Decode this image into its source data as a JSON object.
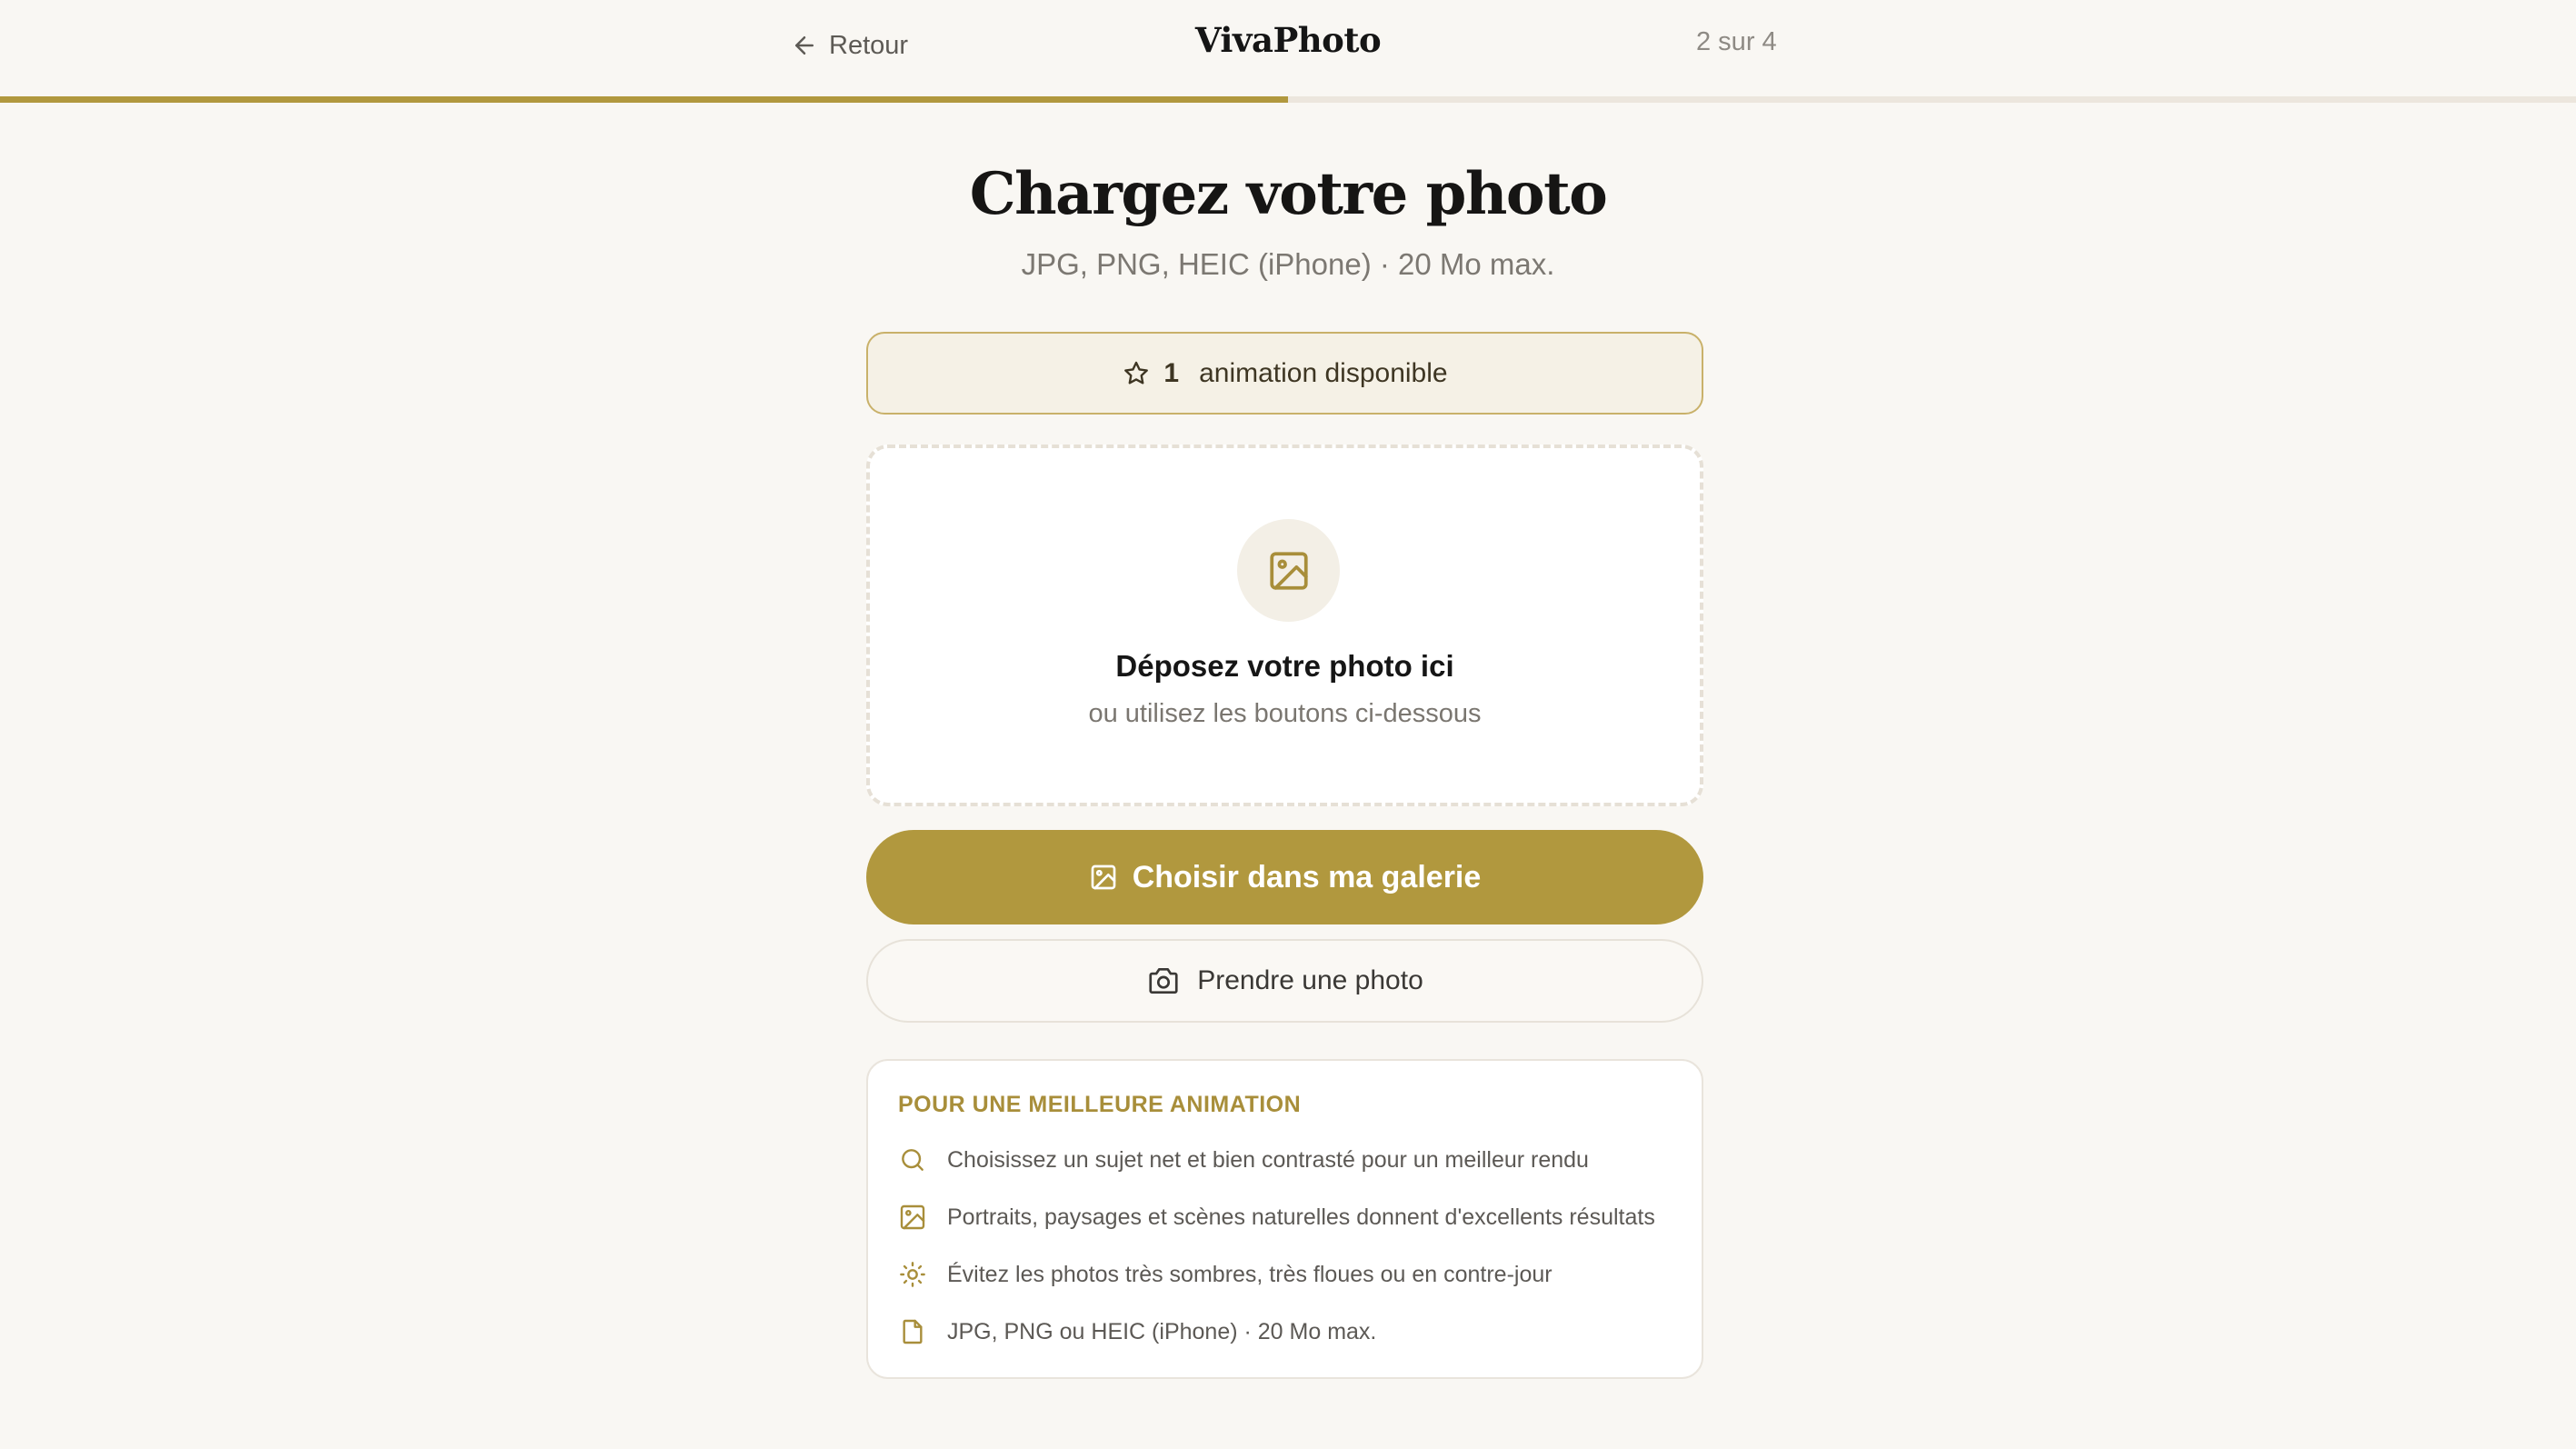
{
  "header": {
    "back_label": "Retour",
    "brand": "VivaPhoto",
    "step": "2 sur 4",
    "progress_percent": 50
  },
  "colors": {
    "accent": "#b1983e",
    "background": "#f9f7f3",
    "track": "#ece6dd"
  },
  "main": {
    "title": "Chargez votre photo",
    "subtitle": "JPG, PNG, HEIC (iPhone) · 20 Mo max."
  },
  "credits": {
    "icon": "star-icon",
    "count": "1",
    "label": "animation disponible"
  },
  "dropzone": {
    "icon": "image-icon",
    "title": "Déposez votre photo ici",
    "subtitle": "ou utilisez les boutons ci-dessous"
  },
  "buttons": {
    "gallery_label": "Choisir dans ma galerie",
    "gallery_icon": "image-icon",
    "camera_label": "Prendre une photo",
    "camera_icon": "camera-icon"
  },
  "tips": {
    "title": "POUR UNE MEILLEURE ANIMATION",
    "items": [
      {
        "icon": "search-icon",
        "text": "Choisissez un sujet net et bien contrasté pour un meilleur rendu"
      },
      {
        "icon": "image-icon",
        "text": "Portraits, paysages et scènes naturelles donnent d'excellents résultats"
      },
      {
        "icon": "sun-icon",
        "text": "Évitez les photos très sombres, très floues ou en contre-jour"
      },
      {
        "icon": "file-icon",
        "text": "JPG, PNG ou HEIC (iPhone) · 20 Mo max."
      }
    ]
  }
}
